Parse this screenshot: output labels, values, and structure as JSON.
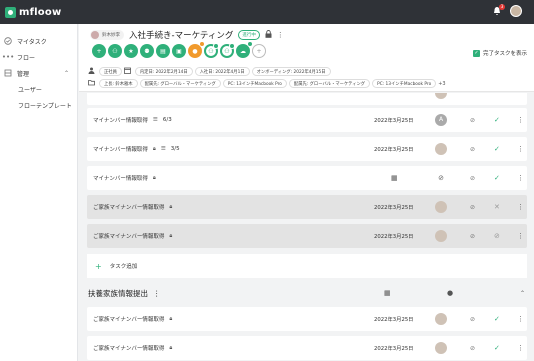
{
  "app": {
    "logo_text": "mfloow",
    "notifications_count": "3"
  },
  "sidebar": {
    "items": [
      {
        "label": "マイタスク",
        "icon": "check-circle-icon"
      },
      {
        "label": "フロー",
        "icon": "dots-icon"
      },
      {
        "label": "管理",
        "icon": "grid-icon"
      }
    ],
    "sub_items": [
      {
        "label": "ユーザー"
      },
      {
        "label": "フローテンプレート"
      }
    ]
  },
  "header": {
    "owner_name": "鈴木妙李",
    "title": "入社手続き-マーケティング",
    "status": "進行中",
    "action_icons": [
      {
        "icon": "plus-icon",
        "color": "#2fb07a"
      },
      {
        "icon": "users-icon",
        "color": "#2fb07a"
      },
      {
        "icon": "star-icon",
        "color": "#2fb07a"
      },
      {
        "icon": "person-add-icon",
        "color": "#2fb07a"
      },
      {
        "icon": "document-icon",
        "color": "#2fb07a"
      },
      {
        "icon": "card-icon",
        "color": "#2fb07a"
      },
      {
        "icon": "lock-icon",
        "color": "#f19a2c"
      },
      {
        "icon": "group-icon",
        "color": "#2fb07a"
      },
      {
        "icon": "people-icon",
        "color": "#2fb07a"
      },
      {
        "icon": "cloud-icon",
        "color": "#2fb07a"
      },
      {
        "icon": "add-circle-icon",
        "color": "#bbbbbb"
      }
    ],
    "show_done_label": "完了タスクを表示",
    "tags_row1": [
      "正社員",
      "内定日: 2022年2月14日",
      "入社日: 2022年4月1日",
      "オンボーディング: 2022年4月15日"
    ],
    "tags_row2": [
      "上長: 鈴木雅木",
      "配属先: グローバル・マーケティング",
      "PC: 13インチMacbook Pro",
      "配属先: グローバル・マーケティング",
      "PC: 13インチMacbook Pro"
    ],
    "tags_more": "+3"
  },
  "tasks": [
    {
      "name": "マイナンバー情報取得",
      "subtasks": "6/3",
      "date": "2022年3月25日",
      "assignee": "A"
    },
    {
      "name": "マイナンバー情報取得",
      "subtasks": "3/5",
      "date": "2022年3月25日",
      "assignee": "photo"
    },
    {
      "name": "マイナンバー情報取得",
      "subtasks": "",
      "date": "",
      "assignee": "none"
    },
    {
      "name": "ご家族マイナンバー情報取得",
      "subtasks": "",
      "date": "2022年3月25日",
      "assignee": "photo"
    },
    {
      "name": "ご家族マイナンバー情報取得",
      "subtasks": "",
      "date": "2022年3月25日",
      "assignee": "photo"
    }
  ],
  "add_task_label": "タスク追加",
  "section2": {
    "title": "扶養家族情報提出",
    "tasks": [
      {
        "name": "ご家族マイナンバー情報取得",
        "date": "2022年3月25日"
      },
      {
        "name": "ご家族マイナンバー情報取得",
        "date": "2022年3月25日"
      }
    ]
  }
}
